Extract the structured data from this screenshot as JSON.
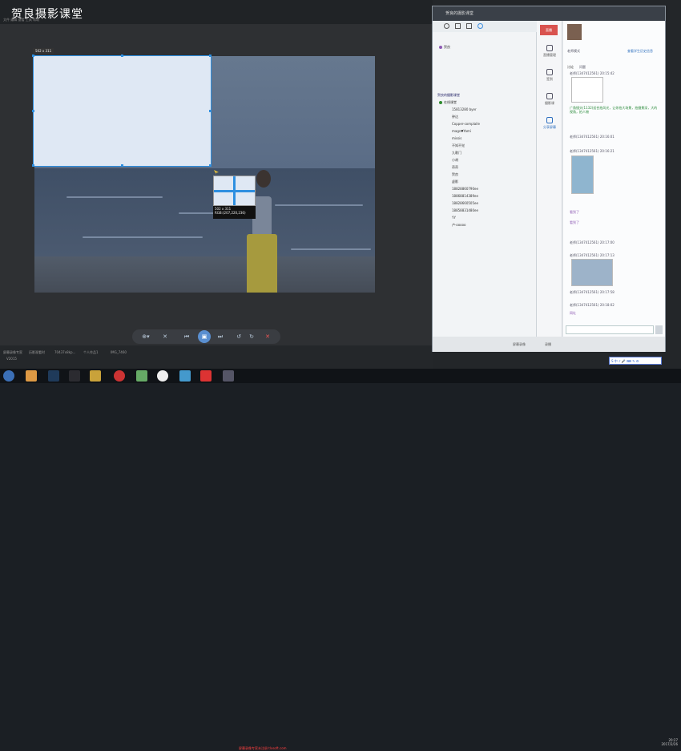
{
  "viewer": {
    "brand": "贺良摄影课堂",
    "menu": "文件  编辑  查看  工具  帮助",
    "selection_size": "502 x 311",
    "magnifier_size": "502 x 311",
    "magnifier_rgb": "RGB:(207,220,236)",
    "toolbar": [
      "⊕▾",
      "✕",
      "⏮",
      "▣",
      "⏭",
      "↺",
      "↻",
      "✕"
    ],
    "status": [
      "屏幕录像专家",
      "历影观看时",
      "70437x8kp...",
      "个人作品1",
      "IMG_7460"
    ],
    "status_sub": "V2015"
  },
  "chat": {
    "title": "贺良的摄影课堂",
    "live_badge": "直播",
    "side_items": [
      "直播管理",
      "签到",
      "摄影课",
      "分享屏幕"
    ],
    "groups_root": "贺良",
    "class_header": "贺良的摄影课堂",
    "online_label": "在线课堂",
    "members": [
      "15813280 byer",
      "钟达",
      "Copper-complaile",
      "mags♥Yami",
      "missis",
      "不知不觉",
      "九歌门",
      "小胡",
      "奇奇",
      "贺良",
      "虚影",
      "18828860790ee",
      "18868814389ee",
      "18828660505ee",
      "18858831480ee",
      "YY",
      "卢·ooooo"
    ],
    "profile_label": "老师模式",
    "profile_link": "查看学生历史信息",
    "tabs": [
      "讨论",
      "问题"
    ],
    "messages": [
      "老师(1347412561) 20:15:42",
      "广角镜头(1132)适合拍风光，让你拍大场景，拍摄景深，大的视角，拍人物",
      "老师(1347412561) 20:16:01",
      "老师(1347412561) 20:16:21",
      "看到了",
      "老师(1347412561) 20:17:00",
      "老师(1347412561) 20:17:13",
      "看到了",
      "老师(1347412561) 20:17:58",
      "老师(1347412561) 20:18:02",
      "网址"
    ],
    "bottom_items": [
      "屏幕录像",
      "录播"
    ]
  },
  "taskbar": {
    "watermark": "屏幕录像专家未注册 tlxsoft.com",
    "clock_time": "20:27",
    "clock_date": "2017/2/26",
    "ime": "S 中 ♪ 🎤 ⌨ ✎ ⚙"
  },
  "colors": {
    "accent": "#2e8fe0",
    "live": "#d9534f",
    "teacher": "#8e5ab4"
  }
}
